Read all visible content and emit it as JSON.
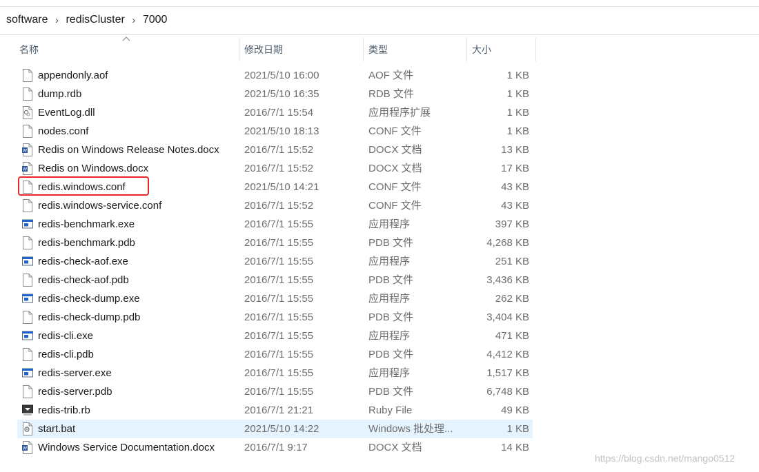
{
  "breadcrumb": [
    "software",
    "redisCluster",
    "7000"
  ],
  "columns": {
    "name": "名称",
    "date": "修改日期",
    "type": "类型",
    "size": "大小"
  },
  "files": [
    {
      "name": "appendonly.aof",
      "date": "2021/5/10 16:00",
      "type": "AOF 文件",
      "size": "1 KB",
      "icon": "blank-file-icon"
    },
    {
      "name": "dump.rdb",
      "date": "2021/5/10 16:35",
      "type": "RDB 文件",
      "size": "1 KB",
      "icon": "blank-file-icon"
    },
    {
      "name": "EventLog.dll",
      "date": "2016/7/1 15:54",
      "type": "应用程序扩展",
      "size": "1 KB",
      "icon": "dll-file-icon"
    },
    {
      "name": "nodes.conf",
      "date": "2021/5/10 18:13",
      "type": "CONF 文件",
      "size": "1 KB",
      "icon": "blank-file-icon"
    },
    {
      "name": "Redis on Windows Release Notes.docx",
      "date": "2016/7/1 15:52",
      "type": "DOCX 文档",
      "size": "13 KB",
      "icon": "docx-file-icon"
    },
    {
      "name": "Redis on Windows.docx",
      "date": "2016/7/1 15:52",
      "type": "DOCX 文档",
      "size": "17 KB",
      "icon": "docx-file-icon"
    },
    {
      "name": "redis.windows.conf",
      "date": "2021/5/10 14:21",
      "type": "CONF 文件",
      "size": "43 KB",
      "icon": "blank-file-icon"
    },
    {
      "name": "redis.windows-service.conf",
      "date": "2016/7/1 15:52",
      "type": "CONF 文件",
      "size": "43 KB",
      "icon": "blank-file-icon"
    },
    {
      "name": "redis-benchmark.exe",
      "date": "2016/7/1 15:55",
      "type": "应用程序",
      "size": "397 KB",
      "icon": "exe-file-icon"
    },
    {
      "name": "redis-benchmark.pdb",
      "date": "2016/7/1 15:55",
      "type": "PDB 文件",
      "size": "4,268 KB",
      "icon": "blank-file-icon"
    },
    {
      "name": "redis-check-aof.exe",
      "date": "2016/7/1 15:55",
      "type": "应用程序",
      "size": "251 KB",
      "icon": "exe-file-icon"
    },
    {
      "name": "redis-check-aof.pdb",
      "date": "2016/7/1 15:55",
      "type": "PDB 文件",
      "size": "3,436 KB",
      "icon": "blank-file-icon"
    },
    {
      "name": "redis-check-dump.exe",
      "date": "2016/7/1 15:55",
      "type": "应用程序",
      "size": "262 KB",
      "icon": "exe-file-icon"
    },
    {
      "name": "redis-check-dump.pdb",
      "date": "2016/7/1 15:55",
      "type": "PDB 文件",
      "size": "3,404 KB",
      "icon": "blank-file-icon"
    },
    {
      "name": "redis-cli.exe",
      "date": "2016/7/1 15:55",
      "type": "应用程序",
      "size": "471 KB",
      "icon": "exe-file-icon"
    },
    {
      "name": "redis-cli.pdb",
      "date": "2016/7/1 15:55",
      "type": "PDB 文件",
      "size": "4,412 KB",
      "icon": "blank-file-icon"
    },
    {
      "name": "redis-server.exe",
      "date": "2016/7/1 15:55",
      "type": "应用程序",
      "size": "1,517 KB",
      "icon": "exe-file-icon"
    },
    {
      "name": "redis-server.pdb",
      "date": "2016/7/1 15:55",
      "type": "PDB 文件",
      "size": "6,748 KB",
      "icon": "blank-file-icon"
    },
    {
      "name": "redis-trib.rb",
      "date": "2016/7/1 21:21",
      "type": "Ruby File",
      "size": "49 KB",
      "icon": "ruby-file-icon"
    },
    {
      "name": "start.bat",
      "date": "2021/5/10 14:22",
      "type": "Windows 批处理...",
      "size": "1 KB",
      "icon": "bat-file-icon",
      "selected": true
    },
    {
      "name": "Windows Service Documentation.docx",
      "date": "2016/7/1 9:17",
      "type": "DOCX 文档",
      "size": "14 KB",
      "icon": "docx-file-icon"
    }
  ],
  "highlighted_file": "redis.windows.conf",
  "colors": {
    "selection": "#e5f3ff",
    "highlight_box": "#e8262a",
    "docx_blue": "#2b579a",
    "exe_blue": "#1e64c8"
  },
  "watermark": "https://blog.csdn.net/mango0512"
}
